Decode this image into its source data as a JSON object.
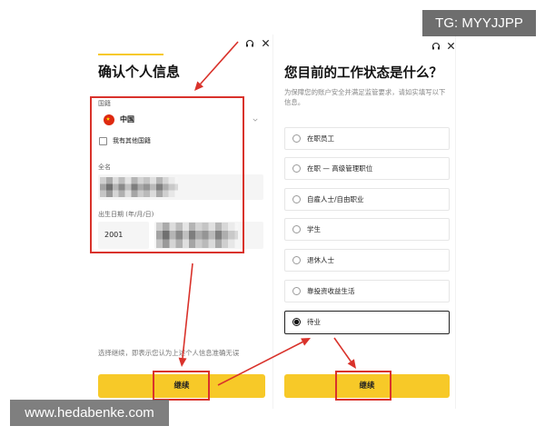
{
  "watermarks": {
    "top_right": "TG: MYYJJPP",
    "bottom_left": "www.hedabenke.com"
  },
  "colors": {
    "accent": "#f7c928",
    "annotation": "#d9322b",
    "text": "#1a1a1a",
    "muted": "#888888"
  },
  "personal_info": {
    "header_icons": [
      "headset-icon",
      "close-icon"
    ],
    "title": "确认个人信息",
    "nationality": {
      "label": "国籍",
      "flag_icon": "china-flag-icon",
      "value": "中国"
    },
    "other_nationality": {
      "label": "我有其他国籍",
      "checked": false
    },
    "full_name": {
      "label": "全名",
      "value_obscured": true
    },
    "birth_date": {
      "label": "出生日期 (年/月/日)",
      "year": "2001",
      "rest_obscured": true
    },
    "consent_text": "选择继续，即表示您认为上述个人信息准确无误",
    "continue_button": "继续"
  },
  "work_status": {
    "header_icons": [
      "headset-icon",
      "close-icon"
    ],
    "title": "您目前的工作状态是什么？",
    "subtitle": "为保障您的账户安全并满足监管要求，请如实填写以下信息。",
    "options": [
      {
        "label": "在职员工",
        "selected": false
      },
      {
        "label": "在职 — 高级管理职位",
        "selected": false
      },
      {
        "label": "自雇人士/自由职业",
        "selected": false
      },
      {
        "label": "学生",
        "selected": false
      },
      {
        "label": "退休人士",
        "selected": false
      },
      {
        "label": "靠投资收益生活",
        "selected": false
      },
      {
        "label": "待业",
        "selected": true
      }
    ],
    "continue_button": "继续"
  }
}
